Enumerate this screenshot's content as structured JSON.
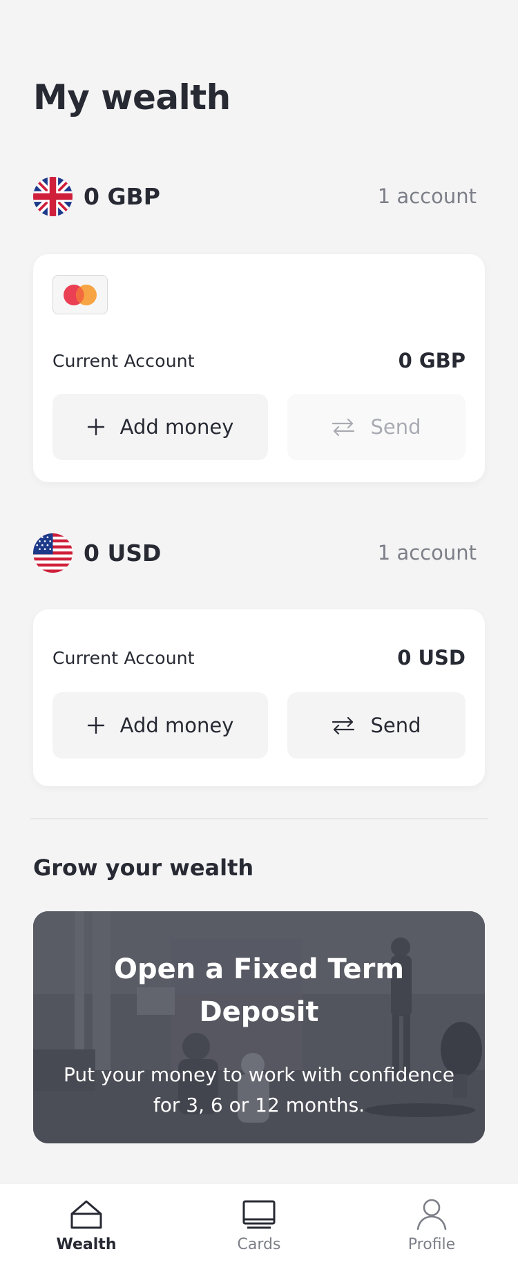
{
  "page": {
    "title": "My wealth"
  },
  "gbp": {
    "total": "0 GBP",
    "count": "1 account",
    "account": {
      "name": "Current Account",
      "balance": "0 GBP"
    },
    "add_label": "Add money",
    "send_label": "Send",
    "send_disabled": true
  },
  "usd": {
    "total": "0 USD",
    "count": "1 account",
    "account": {
      "name": "Current Account",
      "balance": "0 USD"
    },
    "add_label": "Add money",
    "send_label": "Send",
    "send_disabled": false
  },
  "grow": {
    "title": "Grow your wealth",
    "promo_title": "Open a Fixed Term Deposit",
    "promo_text": "Put your money to work with confidence for 3, 6 or 12 months."
  },
  "tabs": [
    {
      "label": "Wealth",
      "icon": "home-icon",
      "active": true
    },
    {
      "label": "Cards",
      "icon": "card-icon",
      "active": false
    },
    {
      "label": "Profile",
      "icon": "person-icon",
      "active": false
    }
  ],
  "icons": {
    "gbp_flag": "uk-flag-icon",
    "usd_flag": "us-flag-icon",
    "card_brand": "mastercard-icon",
    "add": "plus-icon",
    "send": "transfer-arrows-icon"
  },
  "colors": {
    "background": "#f4f4f5",
    "text": "#272a33",
    "muted": "#7c7f87",
    "card": "#ffffff",
    "mastercard_red": "#eb3f53",
    "mastercard_orange": "#f7a03a"
  }
}
